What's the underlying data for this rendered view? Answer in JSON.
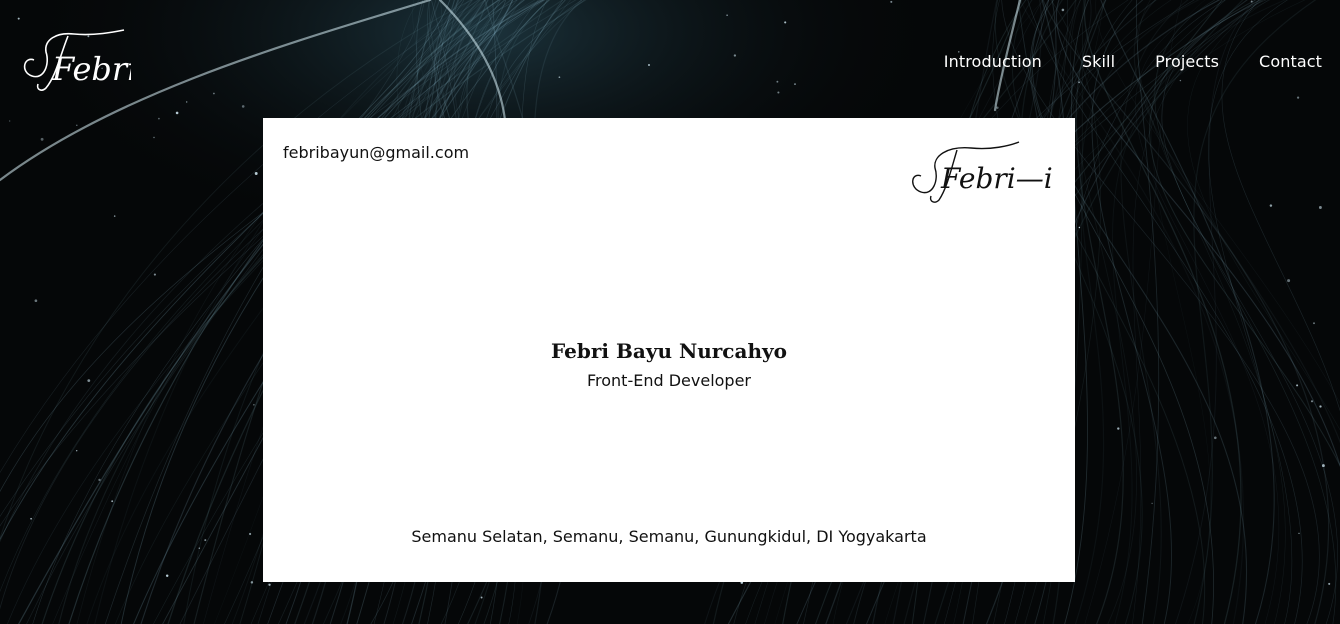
{
  "header": {
    "logo_text": "Febri",
    "nav": [
      {
        "label": "Introduction"
      },
      {
        "label": "Skill"
      },
      {
        "label": "Projects"
      },
      {
        "label": "Contact"
      }
    ]
  },
  "card": {
    "email": "febribayun@gmail.com",
    "signature_text": "Febri—i",
    "name": "Febri Bayu Nurcahyo",
    "role": "Front-End Developer",
    "address": "Semanu Selatan, Semanu, Semanu, Gunungkidul, DI Yogyakarta"
  },
  "theme": {
    "background": "#050708",
    "streak": "#8ab7c8",
    "card": "#ffffff",
    "text": "#111111"
  }
}
